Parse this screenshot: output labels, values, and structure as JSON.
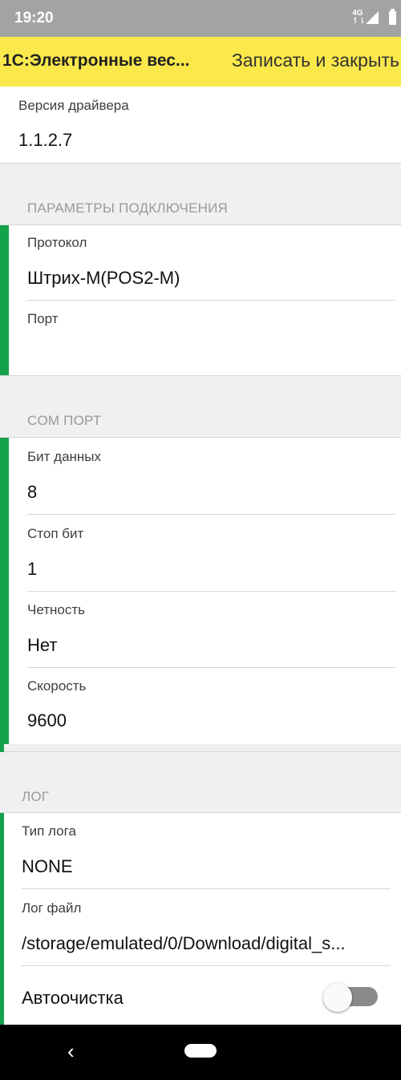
{
  "status_bar": {
    "time": "19:20",
    "network": "4G",
    "icons": [
      "signal-icon",
      "battery-icon"
    ]
  },
  "app_bar": {
    "title": "1С:Электронные вес...",
    "save_close_label": "Записать и закрыть",
    "color": "#fbe84b"
  },
  "driver": {
    "version_label": "Версия драйвера",
    "version_value": "1.1.2.7"
  },
  "connection": {
    "section_title": "ПАРАМЕТРЫ ПОДКЛЮЧЕНИЯ",
    "protocol_label": "Протокол",
    "protocol_value": "Штрих-М(POS2-M)",
    "port_label": "Порт",
    "port_value": ""
  },
  "com_port": {
    "section_title": "COM ПОРТ",
    "data_bits_label": "Бит данных",
    "data_bits_value": "8",
    "stop_bits_label": "Стоп бит",
    "stop_bits_value": "1",
    "parity_label": "Четность",
    "parity_value": "Нет",
    "speed_label": "Скорость",
    "speed_value": "9600"
  },
  "log": {
    "section_title": "ЛОГ",
    "type_label": "Тип лога",
    "type_value": "NONE",
    "file_label": "Лог файл",
    "file_value": "/storage/emulated/0/Download/digital_s...",
    "autoclean_label": "Автоочистка",
    "autoclean_on": false
  },
  "colors": {
    "accent": "#13a14a",
    "background": "#f0f0f0"
  },
  "nav_bar": {
    "icons": [
      "back-icon",
      "home-pill-icon"
    ]
  }
}
